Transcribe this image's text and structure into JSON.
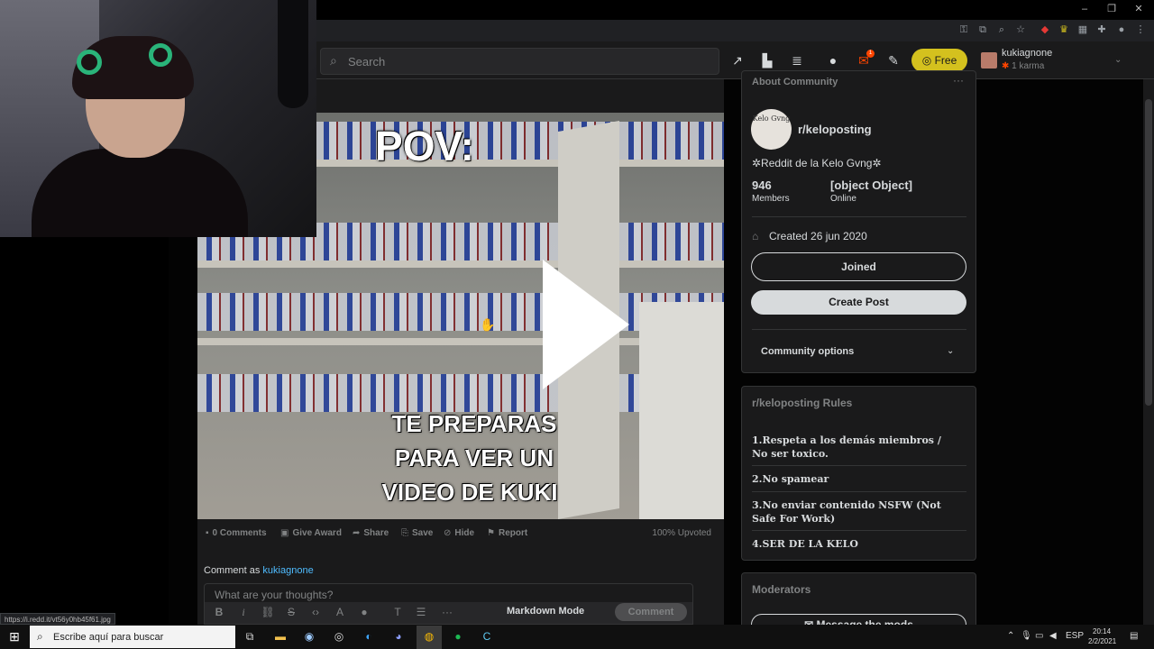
{
  "browser": {
    "window_controls": [
      "–",
      "❐",
      "✕"
    ]
  },
  "header": {
    "search_placeholder": "Search",
    "premium_label": "Free",
    "username": "kukiagnone",
    "karma": "1 karma",
    "notification_count": "1"
  },
  "post": {
    "video_text": {
      "headline": "POV:",
      "line1": "TE PREPARAS",
      "line2": "PARA VER UN",
      "line3": "VIDEO DE KUKI"
    },
    "actions": {
      "comments": "0 Comments",
      "award": "Give Award",
      "share": "Share",
      "save": "Save",
      "hide": "Hide",
      "report": "Report"
    },
    "upvoted": "100% Upvoted",
    "comment_as_label": "Comment as",
    "comment_as_user": "kukiagnone",
    "comment_placeholder": "What are your thoughts?",
    "markdown_mode": "Markdown Mode",
    "comment_button": "Comment"
  },
  "sidebar": {
    "about": {
      "title": "About Community",
      "icon_text": "Kelo Gvng",
      "community_name": "r/keloposting",
      "description": "✲Reddit de la Kelo Gvng✲",
      "members_count": "946",
      "members_label": "Members",
      "online_count": "[object Object]",
      "online_label": "Online",
      "created": "Created 26 jun 2020",
      "joined_button": "Joined",
      "create_post_button": "Create Post",
      "community_options": "Community options"
    },
    "rules": {
      "title": "r/keloposting Rules",
      "items": [
        "1.Respeta a los demás miembros / No ser toxico.",
        "2.No spamear",
        "3.No enviar contenido NSFW (Not Safe For Work)",
        "4.SER DE LA KELO"
      ]
    },
    "moderators": {
      "title": "Moderators",
      "message_button": "Message the mods"
    }
  },
  "status_url": "https://i.redd.it/vt56y0hb45f61.jpg",
  "taskbar": {
    "search_text": "Escribe aquí para buscar",
    "language": "ESP",
    "time": "20:14",
    "date": "2/2/2021"
  },
  "icons": {
    "search": "search-icon",
    "play": "play-icon",
    "colors": {
      "reddit_bg": "#1a1a1b",
      "premium": "#d4c11e",
      "link_blue": "#4fbcff",
      "orange": "#ff4500"
    }
  }
}
